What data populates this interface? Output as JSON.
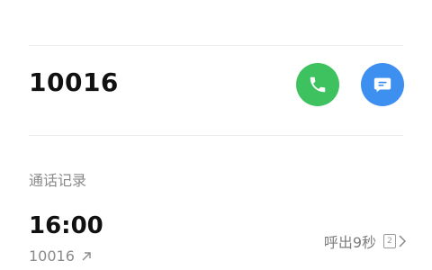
{
  "contact": {
    "number": "10016"
  },
  "actions": {
    "call_color": "#3dc25f",
    "message_color": "#3d8ff0"
  },
  "call_log": {
    "title": "通话记录",
    "entries": [
      {
        "time": "16:00",
        "number": "10016",
        "detail": "呼出9秒",
        "sim": "2",
        "direction_icon": "outgoing-arrow-icon"
      }
    ]
  }
}
